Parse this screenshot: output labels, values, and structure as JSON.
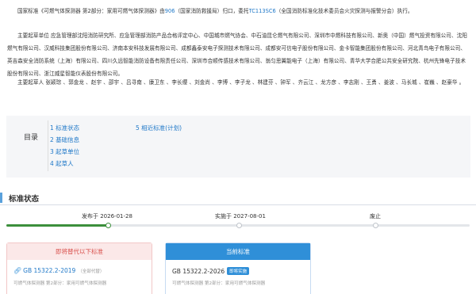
{
  "intro": {
    "t1": "国家标准《可燃气体探测器 第2部分：家用可燃气体探测器》由",
    "num1": "906",
    "t2": "（国家消防救援局）归口，委托",
    "tc": "TC113SC6",
    "t3": "（全国消防标准化技术委员会火灾探测与报警分会）执行。"
  },
  "units": {
    "label": "主要起草单位",
    "text": "应急管理部沈阳消防研究所、应急管理部消防产品合格评定中心、中国城市燃气协会、中石油昆仑燃气有限公司、深圳市中燃科技有限公司、新奥（中国）燃气投资有限公司、沈阳燃气有限公司、汉威科技集团股份有限公司、济南本安科技发展有限公司、成都鑫泰安电子探测技术有限公司、成都安可信电子股份有限公司、金卡智能集团股份有限公司、河北青鸟电子有限公司、英吉森安全消防系统（上海）有限公司、四川久远智能消防设备有限责任公司、深圳市合顺传感技术有限公司、翁匀思翼能电子（上海）有限公司、青华大学合肥公共安全研究院、杭州先锋电子技术股份有限公司、浙江威星智能仪表股份有限公司。"
  },
  "people": {
    "label": "主要起草人",
    "text": "张颖琮 、郭金龙 、赵宇 、邵宇 、吕寻南 、康卫东 、李长缨 、刘金尚 、李博 、李子龙 、林建芬 、钟军 、齐云江 、龙方彦 、李志刚 、王勇 、姜波 、马长城 、崔巍 、赵豪华 。"
  },
  "toc": {
    "title": "目录",
    "items": [
      "1 标准状态",
      "2 基础信息",
      "3 起草单位",
      "4 起草人",
      "5 相近标准(计划)"
    ]
  },
  "status": {
    "title": "标准状态",
    "published": "发布于 2026-01-28",
    "implemented": "实施于 2027-08-01",
    "abolished": "废止",
    "progress_fraction": 0.22
  },
  "cards": {
    "left": {
      "header": "即将替代以下标准",
      "code": "GB 15322.2-2019",
      "note": "（全部代替）",
      "desc": "可燃气体探测器 第2部分：家用可燃气体探测器"
    },
    "right": {
      "header": "当前标准",
      "code": "GB 15322.2-2026",
      "badge": "即将实施",
      "desc": "可燃气体探测器 第2部分：家用可燃气体探测器"
    }
  },
  "colors": {
    "link": "#1f78c8",
    "accent": "#2f8fd8",
    "progress": "#3c8f3c",
    "warn": "#d9534f"
  }
}
